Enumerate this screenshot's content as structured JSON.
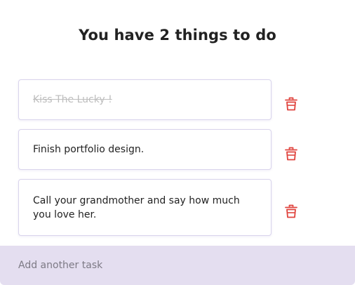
{
  "header": {
    "title": "You have 2 things to do"
  },
  "tasks": [
    {
      "text": "Kiss The Lucky !",
      "completed": true,
      "delete_icon": "trash-icon"
    },
    {
      "text": "Finish portfolio design.",
      "completed": false,
      "delete_icon": "trash-icon"
    },
    {
      "text": "Call your grandmother and say how much you love her.",
      "completed": false,
      "delete_icon": "trash-icon"
    }
  ],
  "add_task": {
    "placeholder": "Add another task",
    "value": ""
  },
  "colors": {
    "accent_bar": "#e4def0",
    "delete_icon": "#e0443e",
    "card_border": "#d9d4ec",
    "completed_text": "#bdbdbd"
  }
}
